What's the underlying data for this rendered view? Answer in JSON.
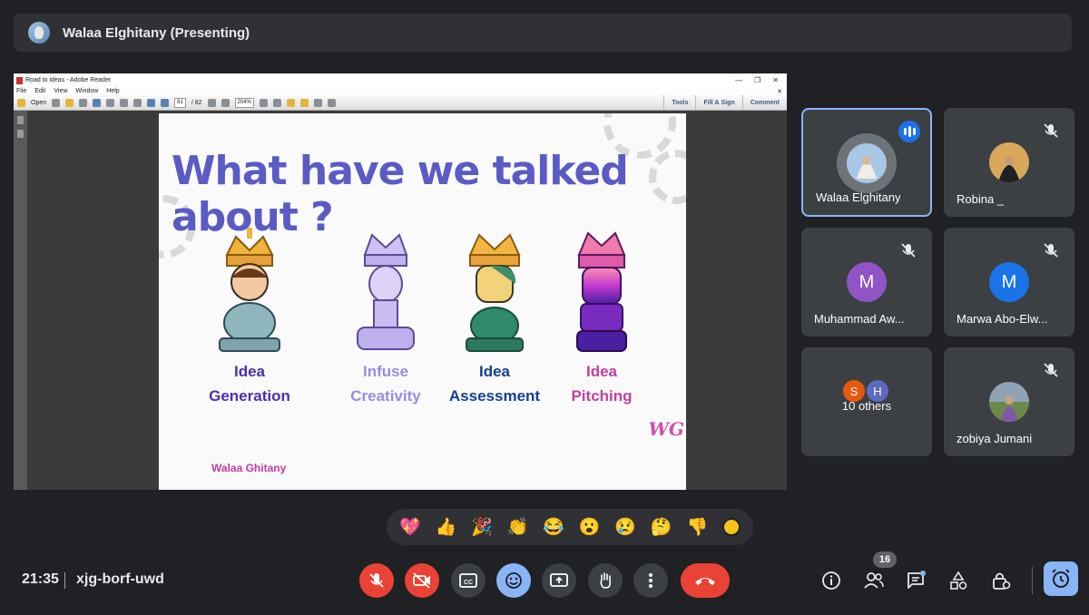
{
  "header": {
    "presenter": "Walaa Elghitany (Presenting)"
  },
  "reader": {
    "window_title": "Road to ideas - Adobe Reader",
    "menu": [
      "File",
      "Edit",
      "View",
      "Window",
      "Help"
    ],
    "open_label": "Open",
    "page_current": "81",
    "page_total": "/ 82",
    "zoom": "204%",
    "tools_label": "Tools",
    "fill_sign_label": "Fill & Sign",
    "comment_label": "Comment"
  },
  "slide": {
    "title": "What have we talked about ?",
    "pieces": [
      {
        "line1": "Idea",
        "line2": "Generation",
        "color": "#4b2fb0"
      },
      {
        "line1": "Infuse",
        "line2": "Creativity",
        "color": "#9a8be0"
      },
      {
        "line1": "Idea",
        "line2": "Assessment",
        "color": "#123f94"
      },
      {
        "line1": "Idea",
        "line2": "Pitching",
        "color": "#c13fa3"
      }
    ],
    "signature": "Walaa Ghitany",
    "logo": "WG"
  },
  "participants": {
    "tiles": [
      {
        "name": "Walaa Elghitany"
      },
      {
        "name": "Robina _"
      },
      {
        "name": "Muhammad Aw...",
        "initial": "M",
        "color": "#9154c6"
      },
      {
        "name": "Marwa Abo-Elw...",
        "initial": "M",
        "color": "#1a73e8"
      },
      {
        "name": "10 others",
        "initials": [
          "S",
          "H"
        ]
      },
      {
        "name": "zobiya Jumani"
      }
    ]
  },
  "reactions": [
    "💖",
    "👍",
    "🎉",
    "👏",
    "😂",
    "😮",
    "😢",
    "🤔",
    "👎"
  ],
  "footer": {
    "time": "21:35",
    "meeting_code": "xjg-borf-uwd",
    "people_count": "16"
  }
}
